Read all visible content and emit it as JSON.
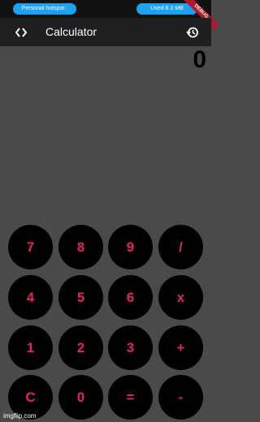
{
  "status_bar": {
    "hotspot_label": "Personal hotspot :",
    "data_label": "Used  8.3 MB",
    "debug_ribbon": "DEBUG"
  },
  "appbar": {
    "title": "Calculator",
    "code_icon": "code-icon",
    "history_icon": "history-icon"
  },
  "display": {
    "value": "0"
  },
  "keypad": {
    "row1": [
      "7",
      "8",
      "9",
      "/"
    ],
    "row2": [
      "4",
      "5",
      "6",
      "x"
    ],
    "row3": [
      "1",
      "2",
      "3",
      "+"
    ],
    "row4": [
      "C",
      "0",
      "=",
      "-"
    ]
  },
  "watermark": "imgflip.com",
  "colors": {
    "key_background": "#000000",
    "key_text": "#e0245e",
    "pill": "#1da1f2",
    "appbar": "#1f1f1f",
    "body": "#4a4a4a"
  }
}
